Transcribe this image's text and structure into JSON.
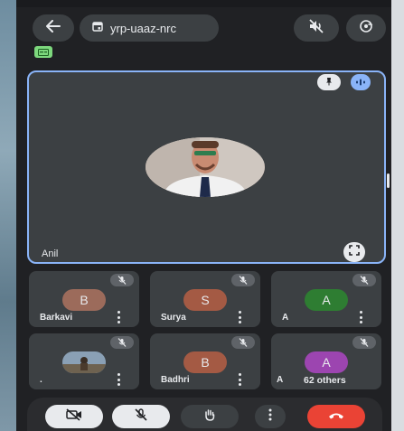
{
  "header": {
    "meeting_code": "yrp-uaaz-nrc"
  },
  "main_speaker": {
    "name": "Anil"
  },
  "participants": [
    {
      "name": "Barkavi",
      "initial": "B",
      "avatar_color": "#9c6b5b",
      "muted": true
    },
    {
      "name": "Surya",
      "initial": "S",
      "avatar_color": "#a45a44",
      "muted": true
    },
    {
      "name": "A",
      "initial": "A",
      "avatar_color": "#2e7d32",
      "muted": true
    },
    {
      "name": ".",
      "initial": "",
      "avatar_color": "#5b6b7d",
      "muted": true
    },
    {
      "name": "Badhri",
      "initial": "B",
      "avatar_color": "#a45a44",
      "muted": true
    },
    {
      "name": "A",
      "initial": "A",
      "avatar_color": "#9c45b0",
      "muted": true
    }
  ],
  "others": {
    "label": "62 others"
  },
  "colors": {
    "accent": "#8ab4f8",
    "end_call": "#ea4335",
    "badge": "#7dd87d"
  },
  "controls": {
    "camera": "camera-off-icon",
    "mic": "mic-off-icon",
    "raise_hand": "hand-icon",
    "more": "more-vert-icon",
    "end_call": "call-end-icon"
  }
}
